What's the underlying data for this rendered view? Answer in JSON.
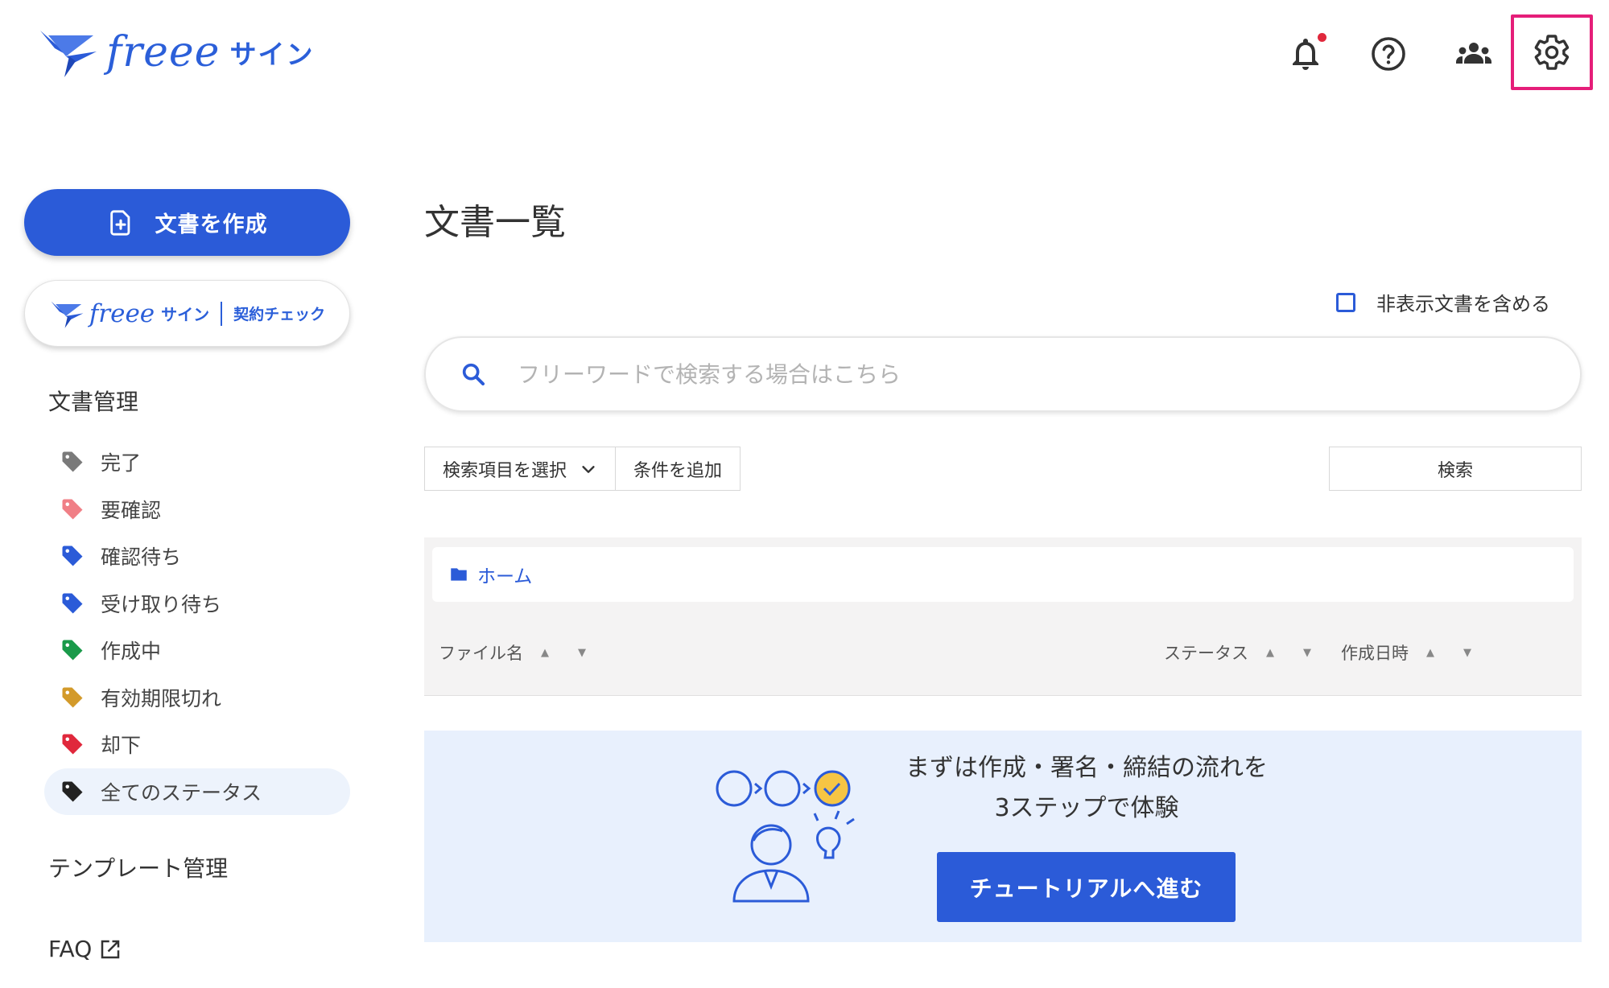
{
  "header": {
    "logo_text": "freee",
    "logo_sub": "サイン",
    "icons": [
      "bell-icon",
      "help-icon",
      "team-icon",
      "gear-icon"
    ],
    "notification_dot_color": "#e0283c",
    "highlight_color": "#e51e79"
  },
  "sidebar": {
    "create_label": "文書を作成",
    "check_logo_text": "freee",
    "check_logo_sub": "サイン",
    "check_label": "契約チェック",
    "doc_heading": "文書管理",
    "statuses": [
      {
        "label": "完了",
        "color": "#7a7a7a"
      },
      {
        "label": "要確認",
        "color": "#f07f86"
      },
      {
        "label": "確認待ち",
        "color": "#2b5bd8"
      },
      {
        "label": "受け取り待ち",
        "color": "#2b5bd8"
      },
      {
        "label": "作成中",
        "color": "#1a9a4a"
      },
      {
        "label": "有効期限切れ",
        "color": "#d39a2a"
      },
      {
        "label": "却下",
        "color": "#e0283c"
      },
      {
        "label": "全てのステータス",
        "color": "#222222"
      }
    ],
    "active_status": "全てのステータス",
    "template_heading": "テンプレート管理",
    "faq_label": "FAQ"
  },
  "main": {
    "title": "文書一覧",
    "include_hidden_label": "非表示文書を含める",
    "search_placeholder": "フリーワードで検索する場合はこちら",
    "select_field_label": "検索項目を選択",
    "add_condition_label": "条件を追加",
    "search_button_label": "検索",
    "breadcrumb_home": "ホーム",
    "columns": {
      "file_name": "ファイル名",
      "status": "ステータス",
      "created_at": "作成日時"
    },
    "tutorial": {
      "line1": "まずは作成・署名・締結の流れを",
      "line2": "3ステップで体験",
      "button": "チュートリアルへ進む"
    }
  },
  "colors": {
    "primary": "#2b5bd8",
    "tutorial_bg": "#e8f0fd",
    "table_bg": "#f4f3f3"
  }
}
